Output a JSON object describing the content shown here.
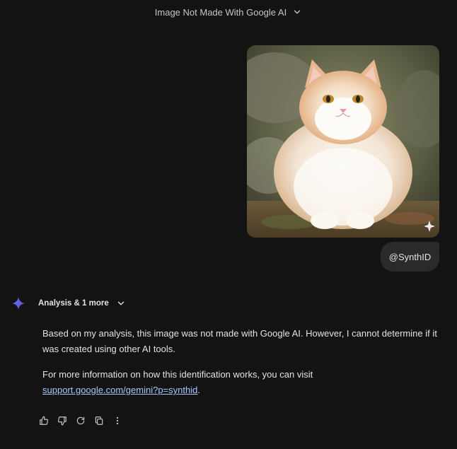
{
  "header": {
    "title": "Image Not Made With Google AI",
    "dropdown_icon": "chevron-down-icon"
  },
  "user_message": {
    "image_subject": "fluffy cream and white cat",
    "text": "@SynthID"
  },
  "response": {
    "chip_label": "Analysis & 1 more",
    "paragraph_1": "Based on my analysis, this image was not made with Google AI. However, I cannot determine if it was created using other AI tools.",
    "paragraph_2_prefix": "For more information on how this identification works, you can visit",
    "link_text": "support.google.com/gemini?p=synthid",
    "paragraph_2_suffix": "."
  },
  "actions": [
    "thumb-up-icon",
    "thumb-down-icon",
    "refresh-icon",
    "copy-icon",
    "more-vert-icon"
  ],
  "colors": {
    "background": "#131314",
    "bubble": "#282a2c",
    "link": "#a8c7fa",
    "text": "#e3e3e3"
  }
}
